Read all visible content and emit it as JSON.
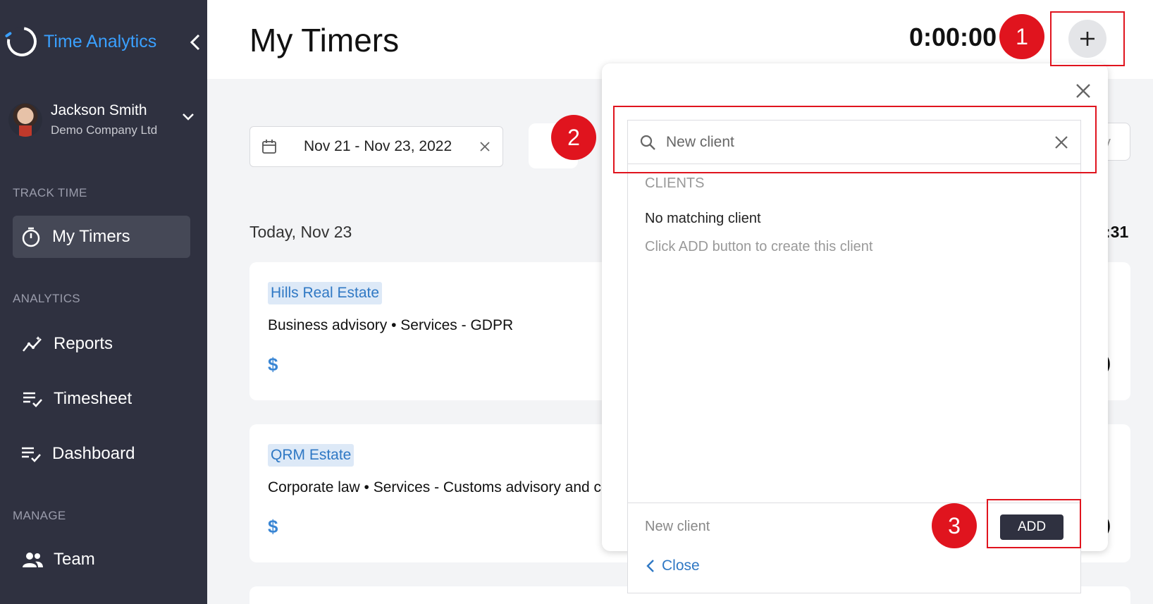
{
  "app": {
    "name": "Time Analytics",
    "brand_color": "#3aa0ff",
    "sidebar_bg": "#2f3140"
  },
  "user": {
    "name": "Jackson Smith",
    "company": "Demo Company Ltd"
  },
  "sidebar": {
    "sections": [
      {
        "label": "TRACK TIME"
      },
      {
        "label": "ANALYTICS"
      },
      {
        "label": "MANAGE"
      }
    ],
    "items": [
      {
        "label": "My Timers",
        "icon": "stopwatch-icon",
        "active": true
      },
      {
        "label": "Reports",
        "icon": "trend-icon"
      },
      {
        "label": "Timesheet",
        "icon": "checklist-icon"
      },
      {
        "label": "Dashboard",
        "icon": "checklist-icon"
      },
      {
        "label": "Team",
        "icon": "people-icon"
      }
    ]
  },
  "header": {
    "title": "My Timers",
    "timer": "0:00:00",
    "add_icon": "plus-icon"
  },
  "filters": {
    "date_range": "Nov 21 - Nov 23, 2022",
    "right_partial": "y"
  },
  "day": {
    "label": "Today, Nov 23",
    "total_partial": ":31"
  },
  "entries": [
    {
      "client": "Hills Real Estate",
      "description": "Business advisory • Services - GDPR",
      "billable_symbol": "$",
      "right_partial": ")"
    },
    {
      "client": "QRM Estate",
      "description": "Corporate law • Services - Customs advisory and co",
      "billable_symbol": "$",
      "right_partial": ")"
    }
  ],
  "client_picker": {
    "search_value": "New client",
    "section_label": "CLIENTS",
    "no_match": "No matching client",
    "hint": "Click ADD button to create this client",
    "footer_value": "New client",
    "add_label": "ADD",
    "close_label": "Close"
  },
  "annotations": {
    "color": "#e0141e",
    "steps": [
      "1",
      "2",
      "3"
    ]
  }
}
